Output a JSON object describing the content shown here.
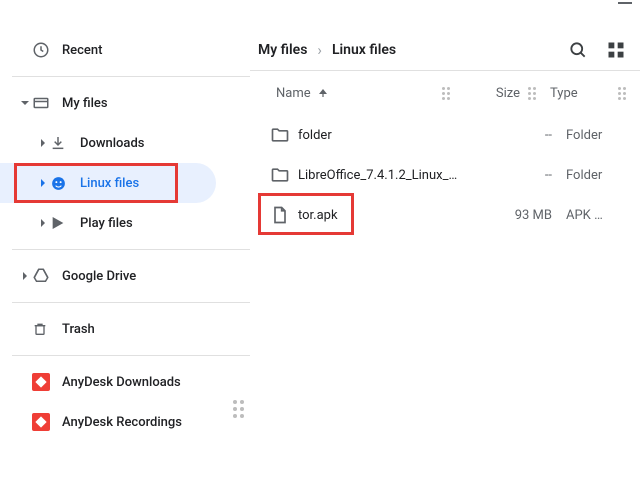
{
  "sidebar": {
    "recent": "Recent",
    "my_files": "My files",
    "downloads": "Downloads",
    "linux_files": "Linux files",
    "play_files": "Play files",
    "google_drive": "Google Drive",
    "trash": "Trash",
    "anydesk_downloads": "AnyDesk Downloads",
    "anydesk_recordings": "AnyDesk Recordings"
  },
  "breadcrumb": {
    "root": "My files",
    "current": "Linux files"
  },
  "columns": {
    "name": "Name",
    "size": "Size",
    "type": "Type"
  },
  "rows": [
    {
      "name": "folder",
      "size": "--",
      "type": "Folder",
      "icon": "folder"
    },
    {
      "name": "LibreOffice_7.4.1.2_Linux_…",
      "size": "--",
      "type": "Folder",
      "icon": "folder"
    },
    {
      "name": "tor.apk",
      "size": "93 MB",
      "type": "APK …",
      "icon": "file"
    }
  ],
  "colors": {
    "accent": "#1a73e8",
    "annotation": "#e53935"
  }
}
